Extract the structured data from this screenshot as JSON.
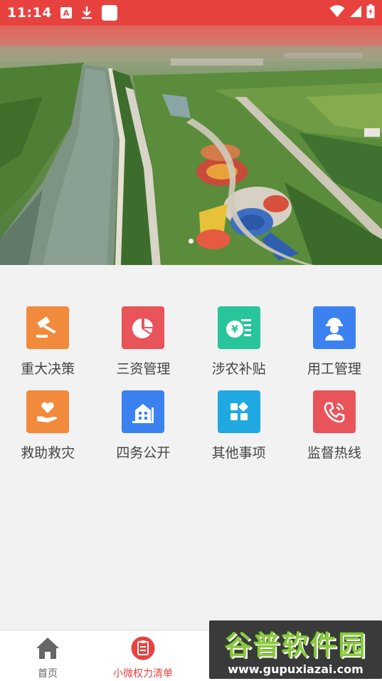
{
  "status_bar": {
    "time": "11:14",
    "icons": [
      "a-icon",
      "download-icon",
      "square-icon",
      "wifi-icon",
      "signal-icon",
      "battery-icon"
    ],
    "a_glyph": "A"
  },
  "banner": {
    "image": "aerial view of canal, park and playground",
    "slide_count": 1,
    "active_slide": 1
  },
  "grid": {
    "items": [
      {
        "label": "重大决策",
        "icon": "gavel-icon",
        "color": "#f28a3c"
      },
      {
        "label": "三资管理",
        "icon": "pie-chart-icon",
        "color": "#e9545b"
      },
      {
        "label": "涉农补贴",
        "icon": "yen-coin-icon",
        "color": "#28c59b"
      },
      {
        "label": "用工管理",
        "icon": "worker-icon",
        "color": "#3b82f0"
      },
      {
        "label": "救助救灾",
        "icon": "heart-hand-icon",
        "color": "#f28a3c"
      },
      {
        "label": "四务公开",
        "icon": "building-icon",
        "color": "#3b82f0"
      },
      {
        "label": "其他事项",
        "icon": "grid-shapes-icon",
        "color": "#1fa9e0"
      },
      {
        "label": "监督热线",
        "icon": "phone-icon",
        "color": "#e9545b"
      }
    ]
  },
  "bottom_nav": {
    "items": [
      {
        "label": "首页",
        "icon": "home-icon",
        "active": false
      },
      {
        "label": "小微权力清单",
        "icon": "clipboard-icon",
        "active": true
      }
    ],
    "active_color": "#e8423f"
  },
  "watermark": {
    "title": "谷普软件园",
    "url": "www.gupuxiazai.com"
  }
}
